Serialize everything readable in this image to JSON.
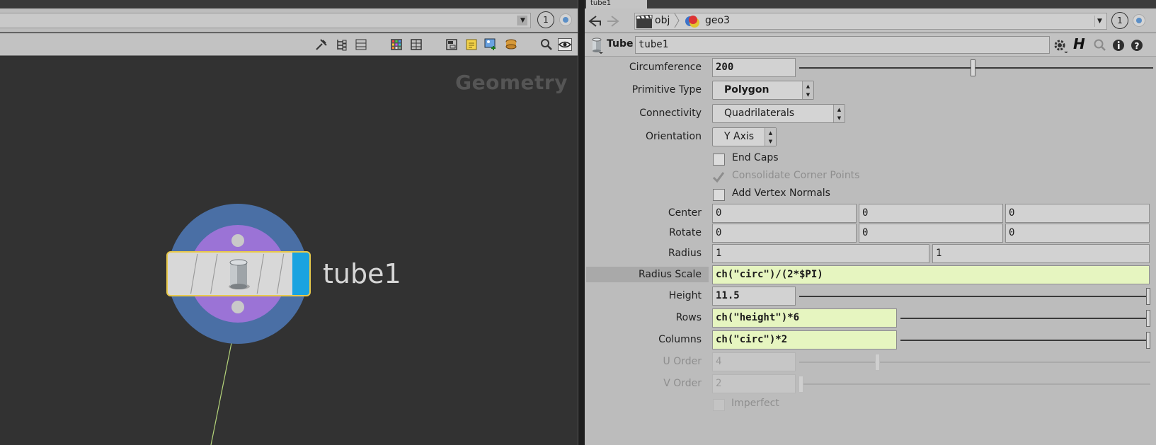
{
  "network": {
    "context_label": "Geometry",
    "viewer_number": "1",
    "node": {
      "name": "tube1"
    },
    "toolbar_icons": [
      "tools-icon",
      "tree-icon",
      "list-icon",
      "color-palette-icon",
      "grid-icon",
      "network-box-icon",
      "sticky-note-icon",
      "background-image-icon",
      "dependency-icon",
      "search-icon",
      "eye-icon"
    ]
  },
  "params": {
    "tab_label": "tube1",
    "path": {
      "obj": "obj",
      "geo": "geo3"
    },
    "viewer_number": "1",
    "node_type": "Tube",
    "node_name": "tube1",
    "circumference": {
      "label": "Circumference",
      "value": "200",
      "slider_fraction": 0.5
    },
    "primitive_type": {
      "label": "Primitive Type",
      "value": "Polygon"
    },
    "connectivity": {
      "label": "Connectivity",
      "value": "Quadrilaterals"
    },
    "orientation": {
      "label": "Orientation",
      "value": "Y Axis"
    },
    "end_caps": {
      "label": "End Caps",
      "checked": false
    },
    "consolidate": {
      "label": "Consolidate Corner Points",
      "checked": true,
      "disabled": true
    },
    "add_vertex_normals": {
      "label": "Add Vertex Normals",
      "checked": false
    },
    "center": {
      "label": "Center",
      "values": [
        "0",
        "0",
        "0"
      ]
    },
    "rotate": {
      "label": "Rotate",
      "values": [
        "0",
        "0",
        "0"
      ]
    },
    "radius": {
      "label": "Radius",
      "values": [
        "1",
        "1"
      ]
    },
    "radius_scale": {
      "label": "Radius Scale",
      "value": "ch(\"circ\")/(2*$PI)"
    },
    "height": {
      "label": "Height",
      "value": "11.5",
      "slider_fraction": 1.0
    },
    "rows": {
      "label": "Rows",
      "value": "ch(\"height\")*6",
      "slider_fraction": 1.0
    },
    "columns": {
      "label": "Columns",
      "value": "ch(\"circ\")*2",
      "slider_fraction": 1.0
    },
    "u_order": {
      "label": "U Order",
      "value": "4",
      "slider_fraction": 0.22
    },
    "v_order": {
      "label": "V Order",
      "value": "2",
      "slider_fraction": 0.0
    },
    "imperfect": {
      "label": "Imperfect",
      "checked": false,
      "disabled": true
    }
  }
}
